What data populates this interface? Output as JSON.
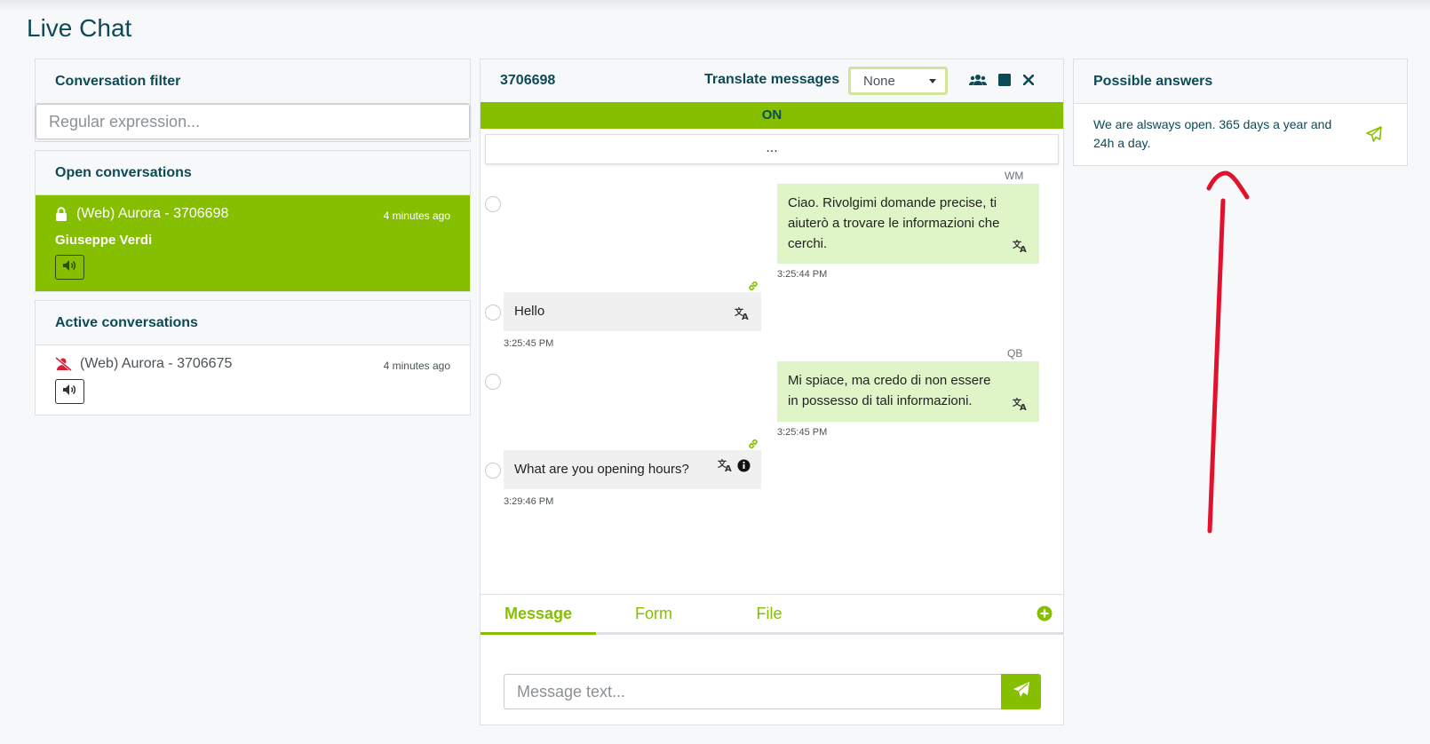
{
  "page": {
    "title": "Live Chat"
  },
  "filter": {
    "header": "Conversation filter",
    "placeholder": "Regular expression..."
  },
  "open_conversations": {
    "header": "Open conversations",
    "items": [
      {
        "label": "(Web) Aurora  - 3706698",
        "time": "4 minutes ago",
        "user": "Giuseppe Verdi",
        "locked": true
      }
    ]
  },
  "active_conversations": {
    "header": "Active conversations",
    "items": [
      {
        "label": "(Web) Aurora  - 3706675",
        "time": "4 minutes ago"
      }
    ]
  },
  "chat": {
    "id": "3706698",
    "translate_label": "Translate messages",
    "language": "None",
    "status": "ON",
    "more": "...",
    "messages": [
      {
        "direction": "out",
        "sender": "WM",
        "text": "Ciao. Rivolgimi domande precise, ti aiuterò a trovare le informazioni che cerchi.",
        "time": "3:25:44 PM"
      },
      {
        "direction": "in",
        "text": "Hello",
        "time": "3:25:45 PM"
      },
      {
        "direction": "out",
        "sender": "QB",
        "text": "Mi spiace, ma credo di non essere in possesso di tali informazioni.",
        "time": "3:25:45 PM"
      },
      {
        "direction": "in",
        "text": "What are you opening hours?",
        "time": "3:29:46 PM"
      }
    ],
    "tabs": [
      {
        "label": "Message"
      },
      {
        "label": "Form"
      },
      {
        "label": "File"
      }
    ],
    "input_placeholder": "Message text..."
  },
  "answers": {
    "header": "Possible answers",
    "items": [
      {
        "text": "We are alsways open. 365 days a year and 24h a day."
      }
    ]
  },
  "colors": {
    "accent": "#86bf00",
    "text": "#0d4a57",
    "annotation": "#e0122e"
  }
}
